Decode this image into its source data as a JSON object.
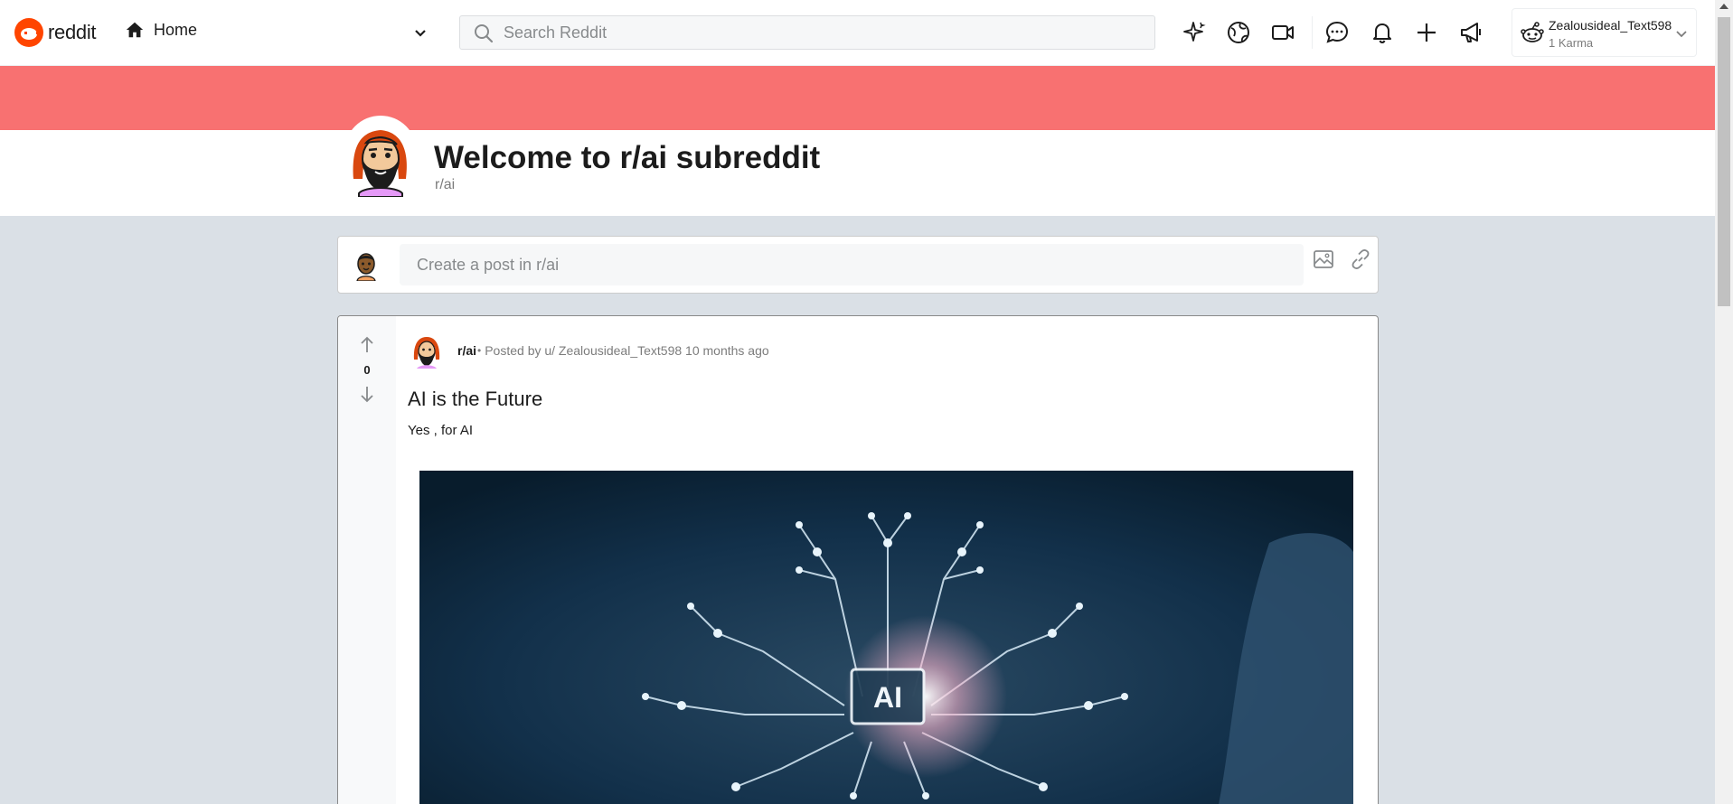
{
  "topnav": {
    "logo_text": "reddit",
    "home_label": "Home",
    "search_placeholder": "Search Reddit",
    "icons": [
      "popular-icon",
      "explore-icon",
      "video-icon",
      "chat-icon",
      "notification-icon",
      "create-icon",
      "advertise-icon"
    ],
    "user": {
      "name": "Zealousideal_Text598",
      "karma": "1 Karma"
    }
  },
  "colors": {
    "brand": "#ff4500",
    "banner": "#f87171",
    "background": "#dae0e6"
  },
  "subreddit": {
    "title": "Welcome to r/ai subreddit",
    "name": "r/ai"
  },
  "create_post": {
    "placeholder": "Create a post in r/ai"
  },
  "post": {
    "votes": "0",
    "subreddit": "r/ai",
    "dot": "•",
    "posted_by": "Posted by u/ Zealousideal_Text598 10 months ago",
    "title": "AI is the Future",
    "body": "Yes , for AI",
    "image_label": "AI"
  }
}
